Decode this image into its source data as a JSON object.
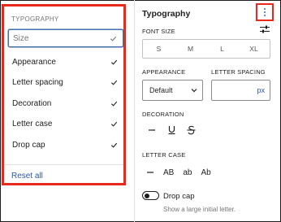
{
  "menu": {
    "heading": "TYPOGRAPHY",
    "items": [
      {
        "label": "Size",
        "checked": true,
        "selected": true
      },
      {
        "label": "Appearance",
        "checked": true,
        "selected": false
      },
      {
        "label": "Letter spacing",
        "checked": true,
        "selected": false
      },
      {
        "label": "Decoration",
        "checked": true,
        "selected": false
      },
      {
        "label": "Letter case",
        "checked": true,
        "selected": false
      },
      {
        "label": "Drop cap",
        "checked": true,
        "selected": false
      }
    ],
    "reset_label": "Reset all"
  },
  "panel": {
    "title": "Typography",
    "options_icon": "kebab-menu-icon",
    "font_size": {
      "label": "FONT SIZE",
      "options": [
        "S",
        "M",
        "L",
        "XL"
      ],
      "custom_icon": "sliders-icon"
    },
    "appearance": {
      "label": "APPEARANCE",
      "value": "Default"
    },
    "letter_spacing": {
      "label": "LETTER SPACING",
      "value": "",
      "unit": "px"
    },
    "decoration": {
      "label": "DECORATION",
      "options": [
        "none",
        "underline",
        "strikethrough"
      ]
    },
    "letter_case": {
      "label": "LETTER CASE",
      "options": [
        "AB",
        "ab",
        "Ab"
      ]
    },
    "drop_cap": {
      "label": "Drop cap",
      "help": "Show a large initial letter.",
      "enabled": false
    }
  },
  "colors": {
    "highlight": "#e8291c",
    "accent": "#2b57a8",
    "focus": "#3d6fb3"
  }
}
